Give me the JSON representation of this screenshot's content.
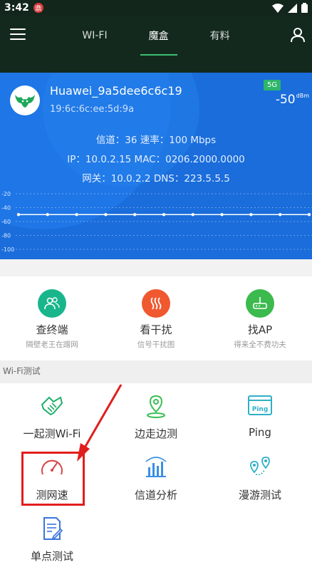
{
  "status_bar": {
    "time": "3:42",
    "notif_glyph": "鼎"
  },
  "tabs": [
    {
      "label": "WI-FI",
      "active": false
    },
    {
      "label": "魔盒",
      "active": true
    },
    {
      "label": "有料",
      "active": false
    }
  ],
  "network": {
    "ssid": "Huawei_9a5dee6c6c19",
    "bssid": "19:6c:6c:ee:5d:9a",
    "band": "5G",
    "signal": "-50",
    "signal_unit": "dBm",
    "line1": "信道：36  速率：100 Mbps",
    "line2": "IP：10.0.2.15  MAC：0206.2000.0000",
    "line3": "网关：10.0.2.2  DNS：223.5.5.5"
  },
  "chart_data": {
    "type": "line",
    "yticks": [
      "-20",
      "-40",
      "-60",
      "-80",
      "-100"
    ],
    "ylim": [
      -100,
      -20
    ],
    "x": [
      0,
      1,
      2,
      3,
      4,
      5,
      6,
      7,
      8,
      9,
      10
    ],
    "series": [
      {
        "values": [
          -50,
          -50,
          -50,
          -50,
          -50,
          -50,
          -50,
          -50,
          -50,
          -50,
          -50
        ]
      }
    ],
    "grid": true
  },
  "tools": [
    {
      "name": "查终端",
      "sub": "隔壁老王在蹭网",
      "color": "#19b68c",
      "icon": "people-icon"
    },
    {
      "name": "看干扰",
      "sub": "信号干扰图",
      "color": "#f0582f",
      "icon": "waves-icon"
    },
    {
      "name": "找AP",
      "sub": "得来全不费功夫",
      "color": "#3cba4d",
      "icon": "router-icon"
    }
  ],
  "section_label": "Wi-Fi测试",
  "tests": [
    {
      "label": "一起测Wi-Fi",
      "icon": "handshake-icon"
    },
    {
      "label": "边走边测",
      "icon": "location-pin-icon"
    },
    {
      "label": "Ping",
      "icon": "ping-window-icon",
      "icon_text": "Ping"
    },
    {
      "label": "测网速",
      "icon": "speedometer-icon"
    },
    {
      "label": "信道分析",
      "icon": "bar-chart-icon"
    },
    {
      "label": "漫游测试",
      "icon": "roaming-pins-icon"
    },
    {
      "label": "单点测试",
      "icon": "document-edit-icon"
    }
  ],
  "colors": {
    "header_bg": "#14291d",
    "accent": "#3bbf73",
    "panel_bg": "#1a6ddb",
    "highlight": "#e11e1e"
  }
}
